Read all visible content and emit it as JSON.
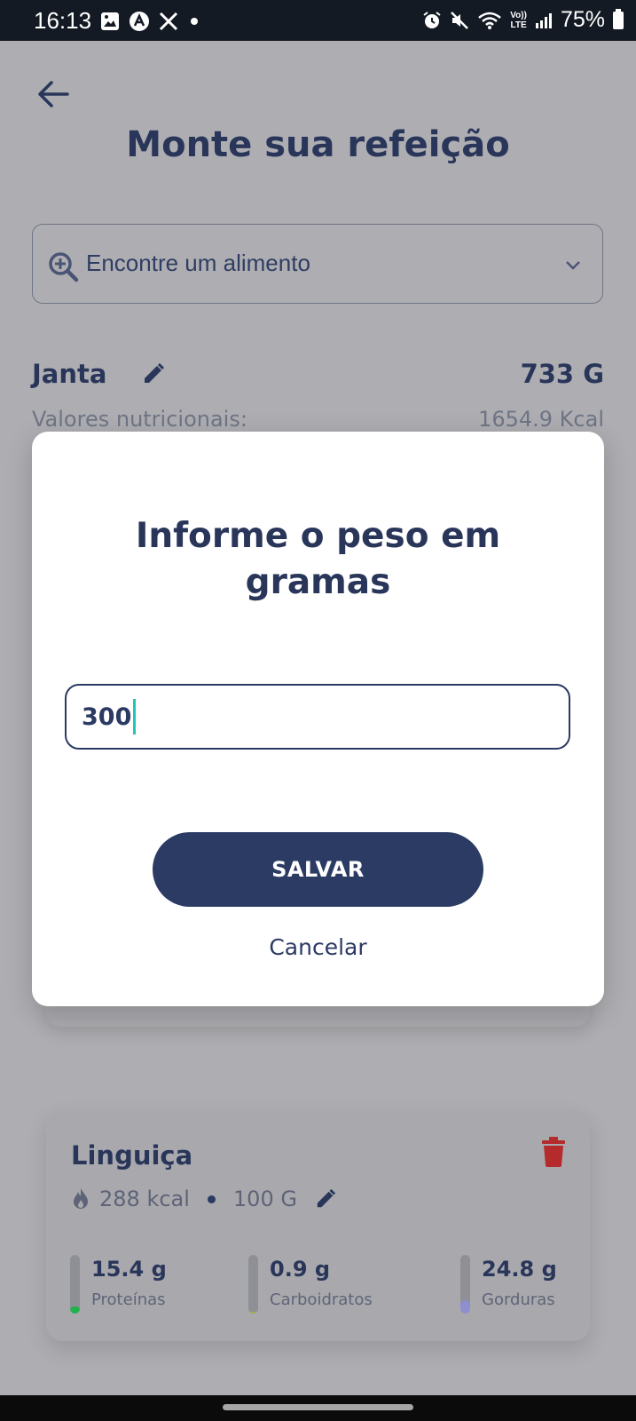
{
  "status_bar": {
    "time": "16:13",
    "battery": "75%",
    "lte_label_top": "Vo))",
    "lte_label_bottom": "LTE",
    "icons": [
      "gallery-icon",
      "app-icon",
      "x-icon",
      "alarm-icon",
      "mute-icon",
      "wifi-icon",
      "volte-icon",
      "signal-icon",
      "battery-icon"
    ]
  },
  "header": {
    "title": "Monte sua refeição"
  },
  "search": {
    "placeholder": "Encontre um alimento"
  },
  "meal": {
    "name": "Janta",
    "weight": "733 G",
    "nutri_label": "Valores nutricionais:",
    "kcal": "1654.9 Kcal"
  },
  "dialog": {
    "title": "Informe o peso em gramas",
    "input_value": "300",
    "save_label": "SALVAR",
    "cancel_label": "Cancelar"
  },
  "food_item": {
    "name": "Linguiça",
    "kcal": "288 kcal",
    "weight": "100 G",
    "macros": [
      {
        "value": "15.4 g",
        "label": "Proteínas",
        "fill_fraction": 0.12,
        "color": "#22b24c"
      },
      {
        "value": "0.9 g",
        "label": "Carboidratos",
        "fill_fraction": 0.03,
        "color": "#9bb24a"
      },
      {
        "value": "24.8 g",
        "label": "Gorduras",
        "fill_fraction": 0.22,
        "color": "#8f8fcf"
      }
    ]
  },
  "colors": {
    "primary": "#2b3b63",
    "accent_caret": "#1fc7b6",
    "delete": "#b52a2a",
    "overlay_bg": "#aeaeb2"
  }
}
